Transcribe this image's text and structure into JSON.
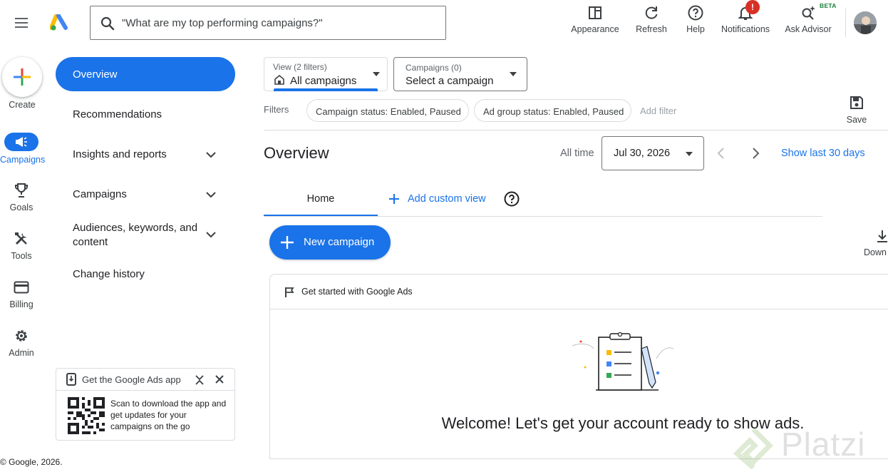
{
  "header": {
    "search_placeholder": "\"What are my top performing campaigns?\"",
    "actions": [
      {
        "label": "Appearance",
        "icon": "appearance-icon"
      },
      {
        "label": "Refresh",
        "icon": "refresh-icon"
      },
      {
        "label": "Help",
        "icon": "help-icon"
      },
      {
        "label": "Notifications",
        "icon": "bell-icon",
        "badge": "!"
      },
      {
        "label": "Ask Advisor",
        "icon": "sparkle-search-icon",
        "tag": "BETA"
      }
    ]
  },
  "rail": {
    "create": "Create",
    "items": [
      {
        "label": "Campaigns",
        "icon": "megaphone-icon",
        "active": true
      },
      {
        "label": "Goals",
        "icon": "trophy-icon"
      },
      {
        "label": "Tools",
        "icon": "tools-icon"
      },
      {
        "label": "Billing",
        "icon": "credit-card-icon"
      },
      {
        "label": "Admin",
        "icon": "gear-icon"
      }
    ]
  },
  "nav": {
    "active": "Overview",
    "items": [
      {
        "label": "Recommendations"
      },
      {
        "label": "Insights and reports"
      },
      {
        "label": "Campaigns"
      },
      {
        "label": "Audiences, keywords, and content"
      },
      {
        "label": "Change history"
      }
    ]
  },
  "view_select": {
    "caption": "View (2 filters)",
    "value": "All campaigns"
  },
  "campaign_select": {
    "caption": "Campaigns (0)",
    "value": "Select a campaign"
  },
  "filters": {
    "label": "Filters",
    "chips": [
      "Campaign status: Enabled, Paused",
      "Ad group status: Enabled, Paused"
    ],
    "add": "Add filter",
    "save": "Save"
  },
  "overview": {
    "title": "Overview",
    "range_label": "All time",
    "date": "Jul 30, 2026",
    "show_last": "Show last 30 days"
  },
  "tabs": {
    "home": "Home",
    "add_view": "Add custom view"
  },
  "new_campaign": "New campaign",
  "download": "Down",
  "card": {
    "header": "Get started with Google Ads",
    "welcome": "Welcome! Let's get your account ready to show ads."
  },
  "promo": {
    "title": "Get the Google Ads app",
    "body": "Scan to download the app and get updates for your campaigns on the go"
  },
  "footer": "© Google, 2026.",
  "watermark": "Platzi",
  "colors": {
    "accent": "#1a73e8",
    "alert": "#d93025",
    "beta": "#188038"
  }
}
